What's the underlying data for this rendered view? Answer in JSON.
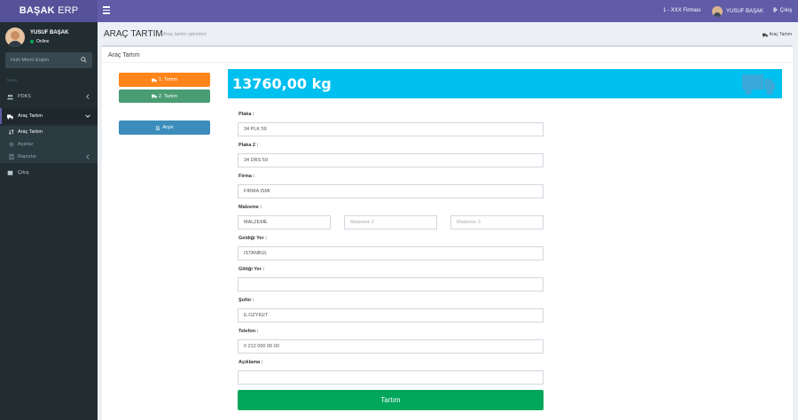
{
  "app": {
    "logo_bold": "BAŞAK",
    "logo_rest": " ERP",
    "company": "1 - XXX Firması",
    "user_name": "YUSUF BAŞAK",
    "logout": "Çıkış"
  },
  "sidebar": {
    "user_name": "YUSUF BAŞAK",
    "user_status": "Online",
    "search_placeholder": "Hızlı Menü Erişim",
    "header": "Menü",
    "items": [
      {
        "label": "PDKS"
      },
      {
        "label": "Araç Tartım"
      },
      {
        "label": "Çıkış"
      }
    ],
    "sub_items": [
      {
        "label": "Araç Tartım"
      },
      {
        "label": "Ayarlar"
      },
      {
        "label": "Raporlar"
      }
    ]
  },
  "page": {
    "title": "ARAÇ TARTIM",
    "subtitle": "Araç tartım işlemleri",
    "breadcrumb": "Araç Tartım",
    "box_title": "Araç Tartım"
  },
  "buttons": {
    "first_weigh": "1. Tartım",
    "second_weigh": "2. Tartım",
    "archive": "Arşiv",
    "submit": "Tartım"
  },
  "weight": "13760,00 kg",
  "form": {
    "plate_label": "Plaka :",
    "plate_value": "34 PLK 59",
    "plate2_label": "Plaka 2 :",
    "plate2_value": "34 DRS 59",
    "company_label": "Firma :",
    "company_value": "FİRMA İSMİ",
    "material_label": "Malzeme :",
    "material_value": "MALZEME",
    "material2_placeholder": "Malzeme 2",
    "material3_placeholder": "Malzeme 3",
    "origin_label": "Geldiği Yer :",
    "origin_value": "İSTANBUL",
    "destination_label": "Gittiği Yer :",
    "destination_value": "",
    "driver_label": "Şoför :",
    "driver_value": "E.ÖZYİĞİT",
    "phone_label": "Telefon :",
    "phone_value": "0 212 000 00 00",
    "notes_label": "Açıklama :",
    "notes_value": ""
  },
  "colors": {
    "header": "#605ca8",
    "sidebar": "#222d32",
    "orange": "#ff851b",
    "green": "#4a9c74",
    "blue": "#3c8dbc",
    "weight_bar": "#00c0ef",
    "submit": "#00a65a"
  }
}
